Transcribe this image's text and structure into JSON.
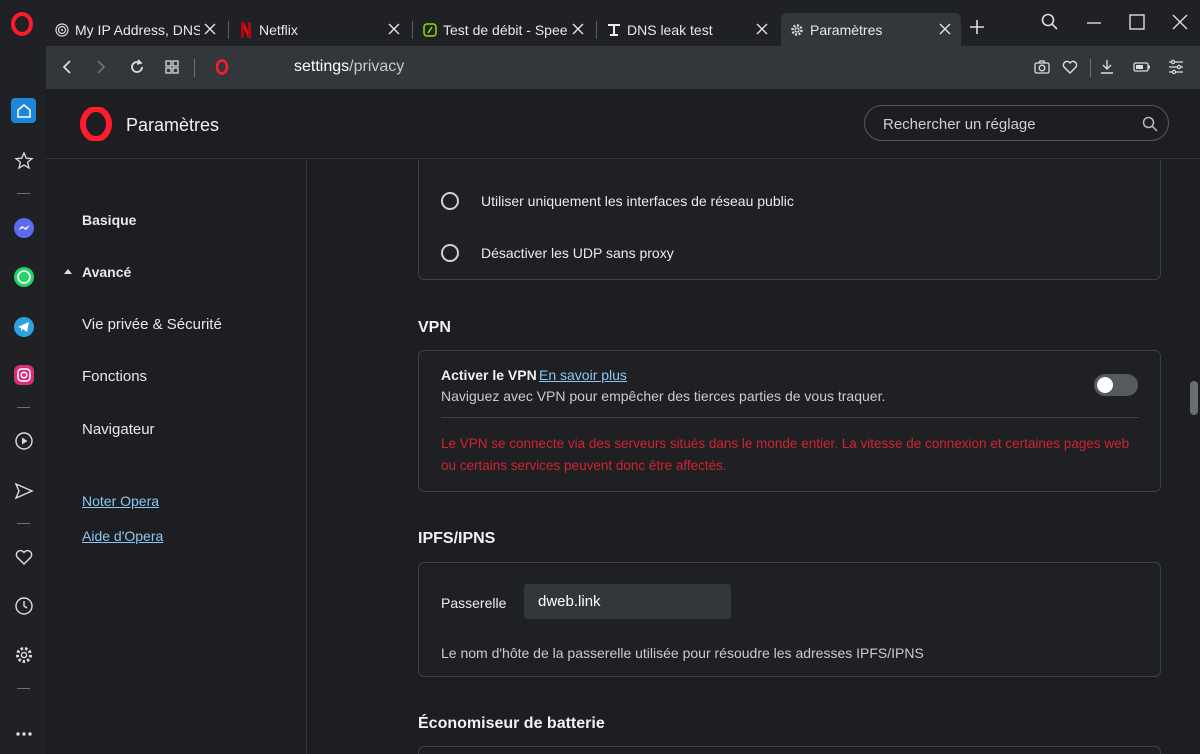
{
  "colors": {
    "opera_red": "#ff1b2d",
    "accent_blue": "#8ec7f3",
    "warning_red": "#d02430"
  },
  "tabs": [
    {
      "title": "My IP Address, DNS L",
      "icon": "fingerprint-icon",
      "active": false
    },
    {
      "title": "Netflix",
      "icon": "netflix-icon",
      "active": false
    },
    {
      "title": "Test de débit - Speed",
      "icon": "speedtest-icon",
      "active": false
    },
    {
      "title": "DNS leak test",
      "icon": "dns-leak-icon",
      "active": false
    },
    {
      "title": "Paramètres",
      "icon": "gear-icon",
      "active": true
    }
  ],
  "address": {
    "host": "settings",
    "path": "/privacy"
  },
  "header": {
    "title": "Paramètres",
    "search_placeholder": "Rechercher un réglage"
  },
  "nav": {
    "basic": "Basique",
    "advanced": "Avancé",
    "items": [
      "Vie privée & Sécurité",
      "Fonctions",
      "Navigateur"
    ],
    "links": [
      "Noter Opera",
      "Aide d'Opera"
    ]
  },
  "network": {
    "options": [
      "Utiliser uniquement les interfaces de réseau public",
      "Désactiver les UDP sans proxy"
    ]
  },
  "vpn": {
    "section_title": "VPN",
    "label": "Activer le VPN",
    "learn_more": "En savoir plus",
    "description": "Naviguez avec VPN pour empêcher des tierces parties de vous traquer.",
    "enabled": false,
    "warning": "Le VPN se connecte via des serveurs situés dans le monde entier. La vitesse de connexion et certaines pages web ou certains services peuvent donc être affectés."
  },
  "ipfs": {
    "section_title": "IPFS/IPNS",
    "gateway_label": "Passerelle",
    "gateway_value": "dweb.link",
    "description": "Le nom d'hôte de la passerelle utilisée pour résoudre les adresses IPFS/IPNS"
  },
  "battery": {
    "section_title": "Économiseur de batterie"
  }
}
